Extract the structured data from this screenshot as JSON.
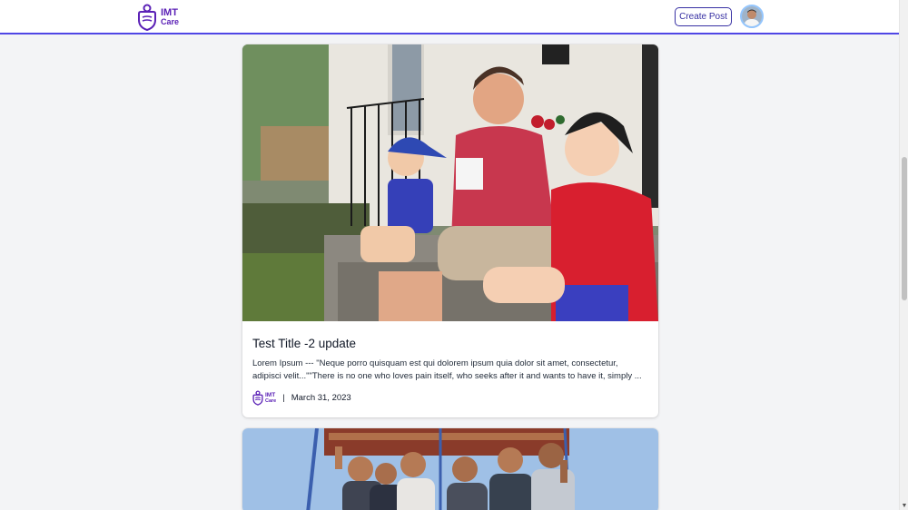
{
  "header": {
    "brand_line1": "IMT",
    "brand_line2": "Care",
    "create_post_label": "Create Post",
    "accent_color": "#4f46e5"
  },
  "posts": [
    {
      "title": "Test Title -2 update",
      "excerpt": "Lorem Ipsum --- \"Neque porro quisquam est qui dolorem ipsum quia dolor sit amet, consectetur, adipisci velit...\"\"There is no one who loves pain itself, who seeks after it and wants to have it, simply ...",
      "author_brand_line1": "IMT",
      "author_brand_line2": "Care",
      "separator": "|",
      "date": "March 31, 2023"
    }
  ]
}
